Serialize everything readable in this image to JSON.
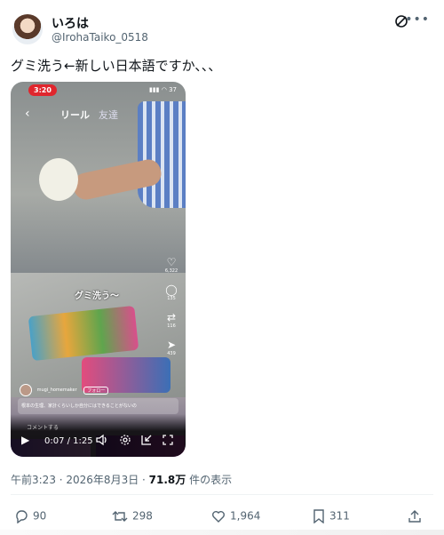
{
  "author": {
    "display_name": "いろは",
    "handle": "@IrohaTaiko_0518"
  },
  "icons": {
    "grok": "grok-icon",
    "more": "more-icon"
  },
  "tweet": {
    "text": "グミ洗う←新しい日本語ですか、、、"
  },
  "video": {
    "status_time": "3:20",
    "status_icons": "▮▮▮ ◠ 37",
    "reel_tabs": {
      "active": "リール",
      "other": "友達"
    },
    "caption": "グミ洗う～",
    "side_rail": [
      {
        "icon": "♡",
        "count": "6,322"
      },
      {
        "icon": "◯",
        "count": "135"
      },
      {
        "icon": "⇄",
        "count": "116"
      },
      {
        "icon": "➤",
        "count": "439"
      }
    ],
    "poster_name": "mugi_homemaker",
    "follow_label": "フォロー",
    "description": "根本の生理、家計くらいしか自分にはできることがないの",
    "comment_placeholder": "コメントする",
    "elapsed": "0:07 / 1:25"
  },
  "meta": {
    "timestamp": "午前3:23 · 2026年8月3日 · ",
    "views_count": "71.8万",
    "views_label": " 件の表示"
  },
  "actions": {
    "replies": "90",
    "reposts": "298",
    "likes": "1,964",
    "bookmarks": "311"
  }
}
